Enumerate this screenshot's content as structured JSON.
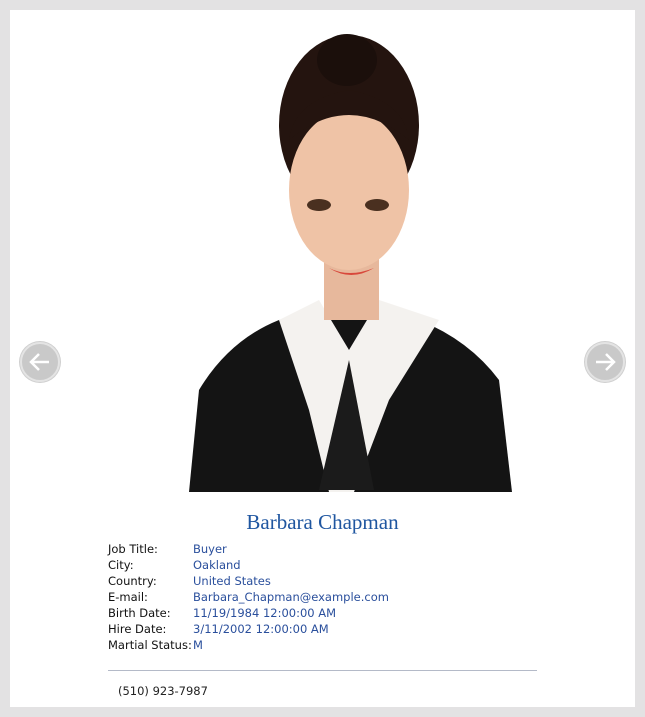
{
  "employee": {
    "name": "Barbara Chapman",
    "fields": [
      {
        "label": "Job Title:",
        "value": "Buyer"
      },
      {
        "label": "City:",
        "value": "Oakland"
      },
      {
        "label": "Country:",
        "value": "United States"
      },
      {
        "label": "E-mail:",
        "value": "Barbara_Chapman@example.com"
      },
      {
        "label": "Birth Date:",
        "value": "11/19/1984 12:00:00 AM"
      },
      {
        "label": "Hire Date:",
        "value": "3/11/2002 12:00:00 AM"
      },
      {
        "label": "Martial Status:",
        "value": "M"
      }
    ],
    "phone": "(510) 923-7987"
  },
  "nav": {
    "prev_icon": "arrow-left-icon",
    "next_icon": "arrow-right-icon"
  },
  "colors": {
    "accent": "#1f56a0",
    "value_text": "#2a4f9c",
    "background": "#e3e2e3"
  }
}
